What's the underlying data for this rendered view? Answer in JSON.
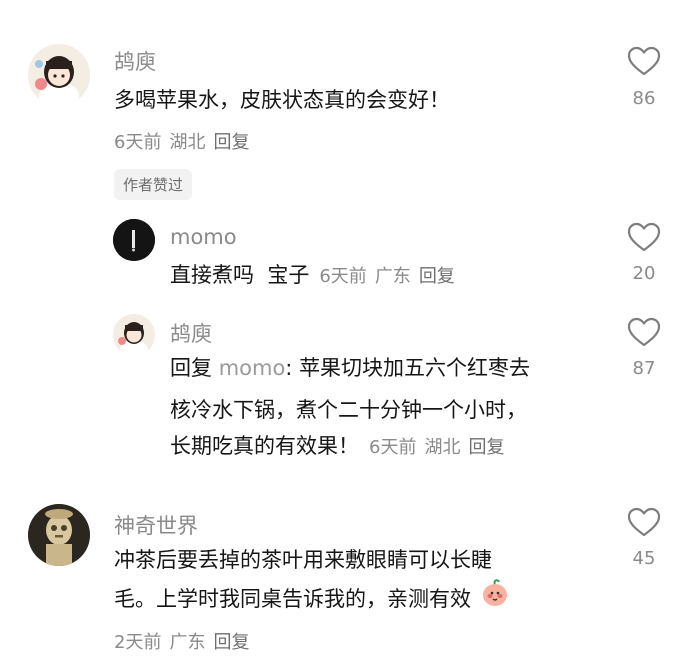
{
  "comments": [
    {
      "user": "鸪庾",
      "text": "多喝苹果水，皮肤状态真的会变好！",
      "time": "6天前",
      "location": "湖北",
      "reply_label": "回复",
      "author_liked": "作者赞过",
      "likes": "86",
      "avatar": "girl-cartoon-avatar"
    },
    {
      "user": "momo",
      "text": "直接煮吗  宝子",
      "time": "6天前",
      "location": "广东",
      "reply_label": "回复",
      "likes": "20",
      "avatar": "dark-avatar"
    },
    {
      "user": "鸪庾",
      "reply_prefix": "回复",
      "reply_to": "momo",
      "lines": [
        "苹果切块加五六个红枣去",
        "核冷水下锅，煮个二十分钟一个小时，",
        "长期吃真的有效果！"
      ],
      "time": "6天前",
      "location": "湖北",
      "reply_label": "回复",
      "likes": "87",
      "avatar": "girl-cartoon-avatar"
    },
    {
      "user": "神奇世界",
      "lines": [
        "冲茶后要丢掉的茶叶用来敷眼睛可以长睫",
        "毛。上学时我同桌告诉我的，亲测有效"
      ],
      "emoji": "shy-peach-emoji",
      "time": "2天前",
      "location": "广东",
      "reply_label": "回复",
      "likes": "45",
      "avatar": "sculpture-avatar"
    }
  ],
  "colors": {
    "text": "#161616",
    "muted": "#8a8a8a",
    "badge_bg": "#f2f2f2"
  }
}
